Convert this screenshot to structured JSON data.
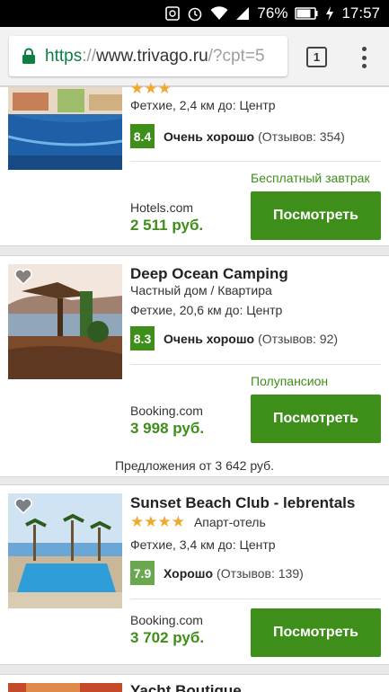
{
  "status": {
    "battery": "76%",
    "time": "17:57"
  },
  "browser": {
    "url_scheme": "https",
    "url_sep": "://",
    "url_host": "www.trivago.ru",
    "url_path": "/?cpt=5",
    "tabs_count": "1"
  },
  "hotels": [
    {
      "name": "",
      "stars_display": "★★★",
      "distance": "Фетхие, 2,4 км до: Центр",
      "score": "8.4",
      "rating_text": "Очень хорошо",
      "reviews": "(Отзывов: 354)",
      "deal": "Бесплатный завтрак",
      "site": "Hotels.com",
      "price": "2 511 руб.",
      "button": "Посмотреть"
    },
    {
      "name": "Deep Ocean Camping",
      "type": "Частный дом / Квартира",
      "distance": "Фетхие, 20,6 км до: Центр",
      "score": "8.3",
      "rating_text": "Очень хорошо",
      "reviews": "(Отзывов: 92)",
      "deal": "Полупансион",
      "site": "Booking.com",
      "price": "3 998 руб.",
      "button": "Посмотреть",
      "offers": "Предложения от 3 642 руб."
    },
    {
      "name": "Sunset Beach Club - lebrentals",
      "stars_display": "★★★★",
      "type": "Апарт-отель",
      "distance": "Фетхие, 3,4 км до: Центр",
      "score": "7.9",
      "rating_text": "Хорошо",
      "reviews": "(Отзывов: 139)",
      "site": "Booking.com",
      "price": "3 702 руб.",
      "button": "Посмотреть"
    },
    {
      "name": "Yacht Boutique"
    }
  ],
  "colors": {
    "accent": "#3e8e1a",
    "star": "#f0a830",
    "url_green": "#0b8043"
  }
}
